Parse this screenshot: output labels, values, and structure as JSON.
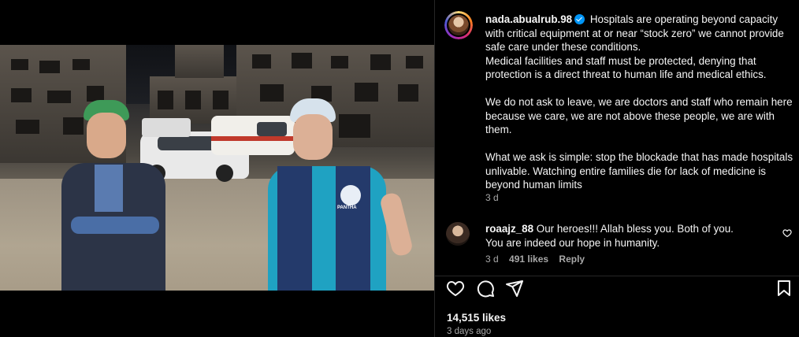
{
  "post": {
    "username": "nada.abualrub.98",
    "verified": true,
    "caption": "Hospitals are operating beyond capacity with critical equipment at or near “stock zero” we cannot provide safe care under these conditions.\nMedical facilities and staff must be protected, denying that protection is a direct threat to human life and medical ethics.\n\nWe do not ask to leave, we are doctors and staff who remain here because we care, we are not above these people, we are with them.\n\nWhat we ask is simple: stop the blockade that has made hospitals unlivable. Watching entire families die for lack of medicine is beyond human limits",
    "time_ago": "3 d",
    "likes": "14,515 likes",
    "date": "3 days ago"
  },
  "comment": {
    "username": "roaajz_88",
    "text": "Our heroes!!! Allah bless you. Both of you. You are indeed our hope in humanity.",
    "time_ago": "3 d",
    "likes": "491 likes",
    "reply_label": "Reply"
  },
  "video": {
    "vest_text": "PANTHA"
  },
  "icons": {
    "mute": "speaker-muted-icon",
    "like": "heart-icon",
    "comment": "comment-bubble-icon",
    "share": "paper-plane-icon",
    "save": "bookmark-icon",
    "comment_like": "small-heart-icon",
    "verified": "verified-badge-icon"
  },
  "colors": {
    "background": "#000000",
    "text": "#f5f5f5",
    "secondary_text": "#a8a8a8",
    "verified": "#0095f6",
    "divider": "#262626"
  }
}
